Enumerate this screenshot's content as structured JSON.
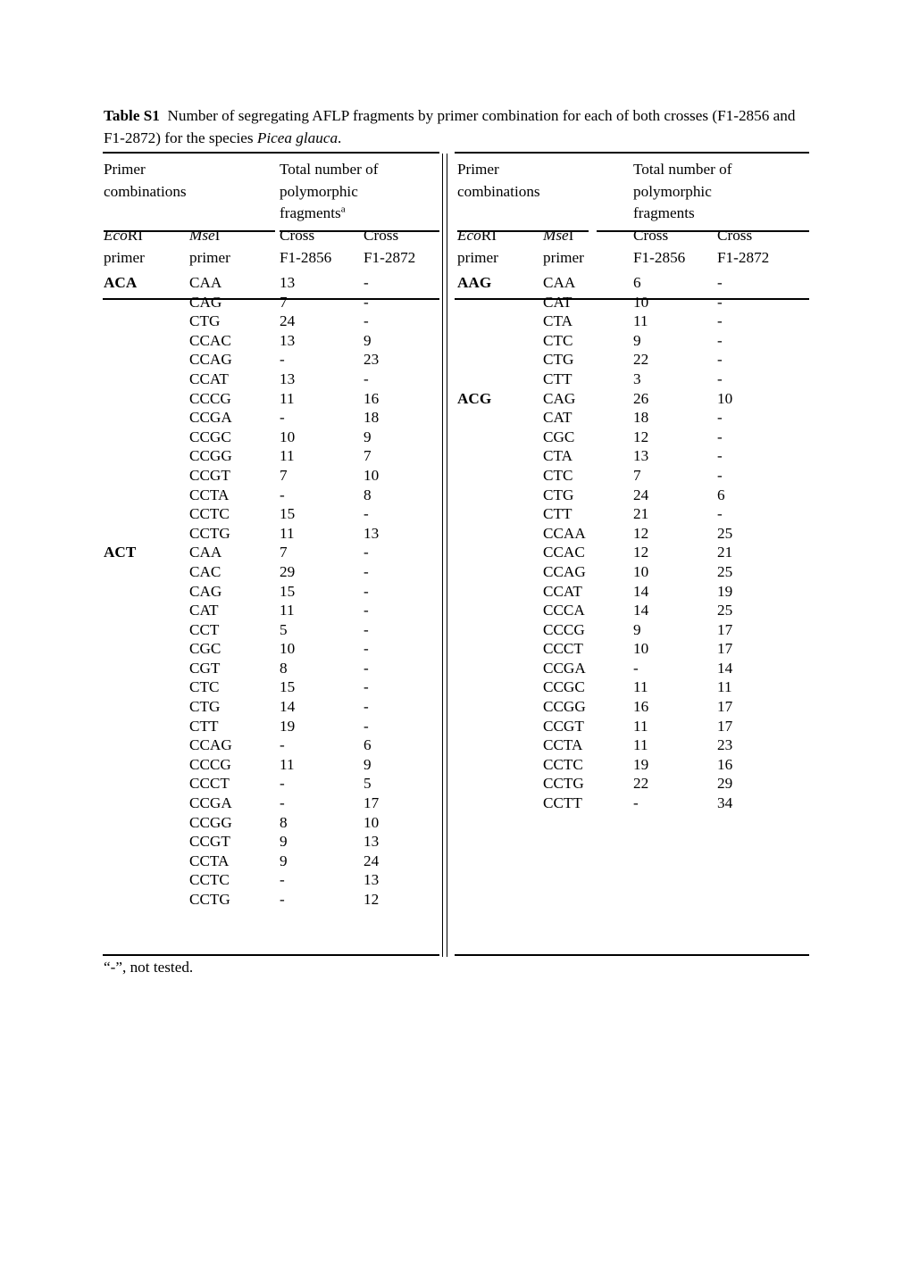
{
  "caption": {
    "label": "Table S1",
    "text_part1": "Number of segregating AFLP fragments by primer combination for each of both crosses (F1-2856 and F1-2872) for the species ",
    "species": "Picea glauca",
    "text_part2": "."
  },
  "tables": [
    {
      "id": "left",
      "group_headers": {
        "primer": "Primer\ncombinations",
        "primer_line1": "Primer",
        "primer_line2": "combinations",
        "fragments_line1": "Total number of",
        "fragments_line2": "polymorphic",
        "fragments_line3": "fragments",
        "fragments_superscript": "a"
      },
      "sub_headers": {
        "ecori_italic": "Eco",
        "ecori_rest": "RI",
        "ecori_line2": "primer",
        "msei_italic": "Mse",
        "msei_rest": "I",
        "msei_line2": "primer",
        "cross1_line1": "Cross",
        "cross1_line2": "F1-2856",
        "cross2_line1": "Cross",
        "cross2_line2": "F1-2872"
      },
      "rows": [
        {
          "ecori": "ACA",
          "msei": "CAA",
          "f2856": "13",
          "f2872": "-"
        },
        {
          "ecori": "",
          "msei": "CAG",
          "f2856": "7",
          "f2872": "-"
        },
        {
          "ecori": "",
          "msei": "CTG",
          "f2856": "24",
          "f2872": "-"
        },
        {
          "ecori": "",
          "msei": "CCAC",
          "f2856": "13",
          "f2872": "9"
        },
        {
          "ecori": "",
          "msei": "CCAG",
          "f2856": "-",
          "f2872": "23"
        },
        {
          "ecori": "",
          "msei": "CCAT",
          "f2856": "13",
          "f2872": "-"
        },
        {
          "ecori": "",
          "msei": "CCCG",
          "f2856": "11",
          "f2872": "16"
        },
        {
          "ecori": "",
          "msei": "CCGA",
          "f2856": "-",
          "f2872": "18"
        },
        {
          "ecori": "",
          "msei": "CCGC",
          "f2856": "10",
          "f2872": "9"
        },
        {
          "ecori": "",
          "msei": "CCGG",
          "f2856": "11",
          "f2872": "7"
        },
        {
          "ecori": "",
          "msei": "CCGT",
          "f2856": "7",
          "f2872": "10"
        },
        {
          "ecori": "",
          "msei": "CCTA",
          "f2856": "-",
          "f2872": "8"
        },
        {
          "ecori": "",
          "msei": "CCTC",
          "f2856": "15",
          "f2872": "-"
        },
        {
          "ecori": "",
          "msei": "CCTG",
          "f2856": "11",
          "f2872": "13"
        },
        {
          "ecori": "ACT",
          "msei": "CAA",
          "f2856": "7",
          "f2872": "-"
        },
        {
          "ecori": "",
          "msei": "CAC",
          "f2856": "29",
          "f2872": "-"
        },
        {
          "ecori": "",
          "msei": "CAG",
          "f2856": "15",
          "f2872": "-"
        },
        {
          "ecori": "",
          "msei": "CAT",
          "f2856": "11",
          "f2872": "-"
        },
        {
          "ecori": "",
          "msei": "CCT",
          "f2856": "5",
          "f2872": "-"
        },
        {
          "ecori": "",
          "msei": "CGC",
          "f2856": "10",
          "f2872": "-"
        },
        {
          "ecori": "",
          "msei": "CGT",
          "f2856": "8",
          "f2872": "-"
        },
        {
          "ecori": "",
          "msei": "CTC",
          "f2856": "15",
          "f2872": "-"
        },
        {
          "ecori": "",
          "msei": "CTG",
          "f2856": "14",
          "f2872": "-"
        },
        {
          "ecori": "",
          "msei": "CTT",
          "f2856": "19",
          "f2872": "-"
        },
        {
          "ecori": "",
          "msei": "CCAG",
          "f2856": "-",
          "f2872": "6"
        },
        {
          "ecori": "",
          "msei": "CCCG",
          "f2856": "11",
          "f2872": "9"
        },
        {
          "ecori": "",
          "msei": "CCCT",
          "f2856": "-",
          "f2872": "5"
        },
        {
          "ecori": "",
          "msei": "CCGA",
          "f2856": "-",
          "f2872": "17"
        },
        {
          "ecori": "",
          "msei": "CCGG",
          "f2856": "8",
          "f2872": "10"
        },
        {
          "ecori": "",
          "msei": "CCGT",
          "f2856": "9",
          "f2872": "13"
        },
        {
          "ecori": "",
          "msei": "CCTA",
          "f2856": "9",
          "f2872": "24"
        },
        {
          "ecori": "",
          "msei": "CCTC",
          "f2856": "-",
          "f2872": "13"
        },
        {
          "ecori": "",
          "msei": "CCTG",
          "f2856": "-",
          "f2872": "12"
        }
      ]
    },
    {
      "id": "right",
      "group_headers": {
        "primer_line1": "Primer",
        "primer_line2": "combinations",
        "fragments_line1": "Total number of",
        "fragments_line2": "polymorphic",
        "fragments_line3": "fragments",
        "fragments_superscript": ""
      },
      "sub_headers": {
        "ecori_italic": "Eco",
        "ecori_rest": "RI",
        "ecori_line2": "primer",
        "msei_italic": "Mse",
        "msei_rest": "I",
        "msei_line2": "primer",
        "cross1_line1": "Cross",
        "cross1_line2": "F1-2856",
        "cross2_line1": "Cross",
        "cross2_line2": "F1-2872"
      },
      "rows": [
        {
          "ecori": "AAG",
          "msei": "CAA",
          "f2856": "6",
          "f2872": "-"
        },
        {
          "ecori": "",
          "msei": "CAT",
          "f2856": "10",
          "f2872": "-"
        },
        {
          "ecori": "",
          "msei": "CTA",
          "f2856": "11",
          "f2872": "-"
        },
        {
          "ecori": "",
          "msei": "CTC",
          "f2856": "9",
          "f2872": "-"
        },
        {
          "ecori": "",
          "msei": "CTG",
          "f2856": "22",
          "f2872": "-"
        },
        {
          "ecori": "",
          "msei": "CTT",
          "f2856": "3",
          "f2872": "-"
        },
        {
          "ecori": "ACG",
          "msei": "CAG",
          "f2856": "26",
          "f2872": "10"
        },
        {
          "ecori": "",
          "msei": "CAT",
          "f2856": "18",
          "f2872": "-"
        },
        {
          "ecori": "",
          "msei": "CGC",
          "f2856": "12",
          "f2872": "-"
        },
        {
          "ecori": "",
          "msei": "CTA",
          "f2856": "13",
          "f2872": "-"
        },
        {
          "ecori": "",
          "msei": "CTC",
          "f2856": "7",
          "f2872": "-"
        },
        {
          "ecori": "",
          "msei": "CTG",
          "f2856": "24",
          "f2872": "6"
        },
        {
          "ecori": "",
          "msei": "CTT",
          "f2856": "21",
          "f2872": "-"
        },
        {
          "ecori": "",
          "msei": "CCAA",
          "f2856": "12",
          "f2872": "25"
        },
        {
          "ecori": "",
          "msei": "CCAC",
          "f2856": "12",
          "f2872": "21"
        },
        {
          "ecori": "",
          "msei": "CCAG",
          "f2856": "10",
          "f2872": "25"
        },
        {
          "ecori": "",
          "msei": "CCAT",
          "f2856": "14",
          "f2872": "19"
        },
        {
          "ecori": "",
          "msei": "CCCA",
          "f2856": "14",
          "f2872": "25"
        },
        {
          "ecori": "",
          "msei": "CCCG",
          "f2856": "9",
          "f2872": "17"
        },
        {
          "ecori": "",
          "msei": "CCCT",
          "f2856": "10",
          "f2872": "17"
        },
        {
          "ecori": "",
          "msei": "CCGA",
          "f2856": "-",
          "f2872": "14"
        },
        {
          "ecori": "",
          "msei": "CCGC",
          "f2856": "11",
          "f2872": "11"
        },
        {
          "ecori": "",
          "msei": "CCGG",
          "f2856": "16",
          "f2872": "17"
        },
        {
          "ecori": "",
          "msei": "CCGT",
          "f2856": "11",
          "f2872": "17"
        },
        {
          "ecori": "",
          "msei": "CCTA",
          "f2856": "11",
          "f2872": "23"
        },
        {
          "ecori": "",
          "msei": "CCTC",
          "f2856": "19",
          "f2872": "16"
        },
        {
          "ecori": "",
          "msei": "CCTG",
          "f2856": "22",
          "f2872": "29"
        },
        {
          "ecori": "",
          "msei": "CCTT",
          "f2856": "-",
          "f2872": "34"
        }
      ]
    }
  ],
  "footnote": "“-”, not tested."
}
